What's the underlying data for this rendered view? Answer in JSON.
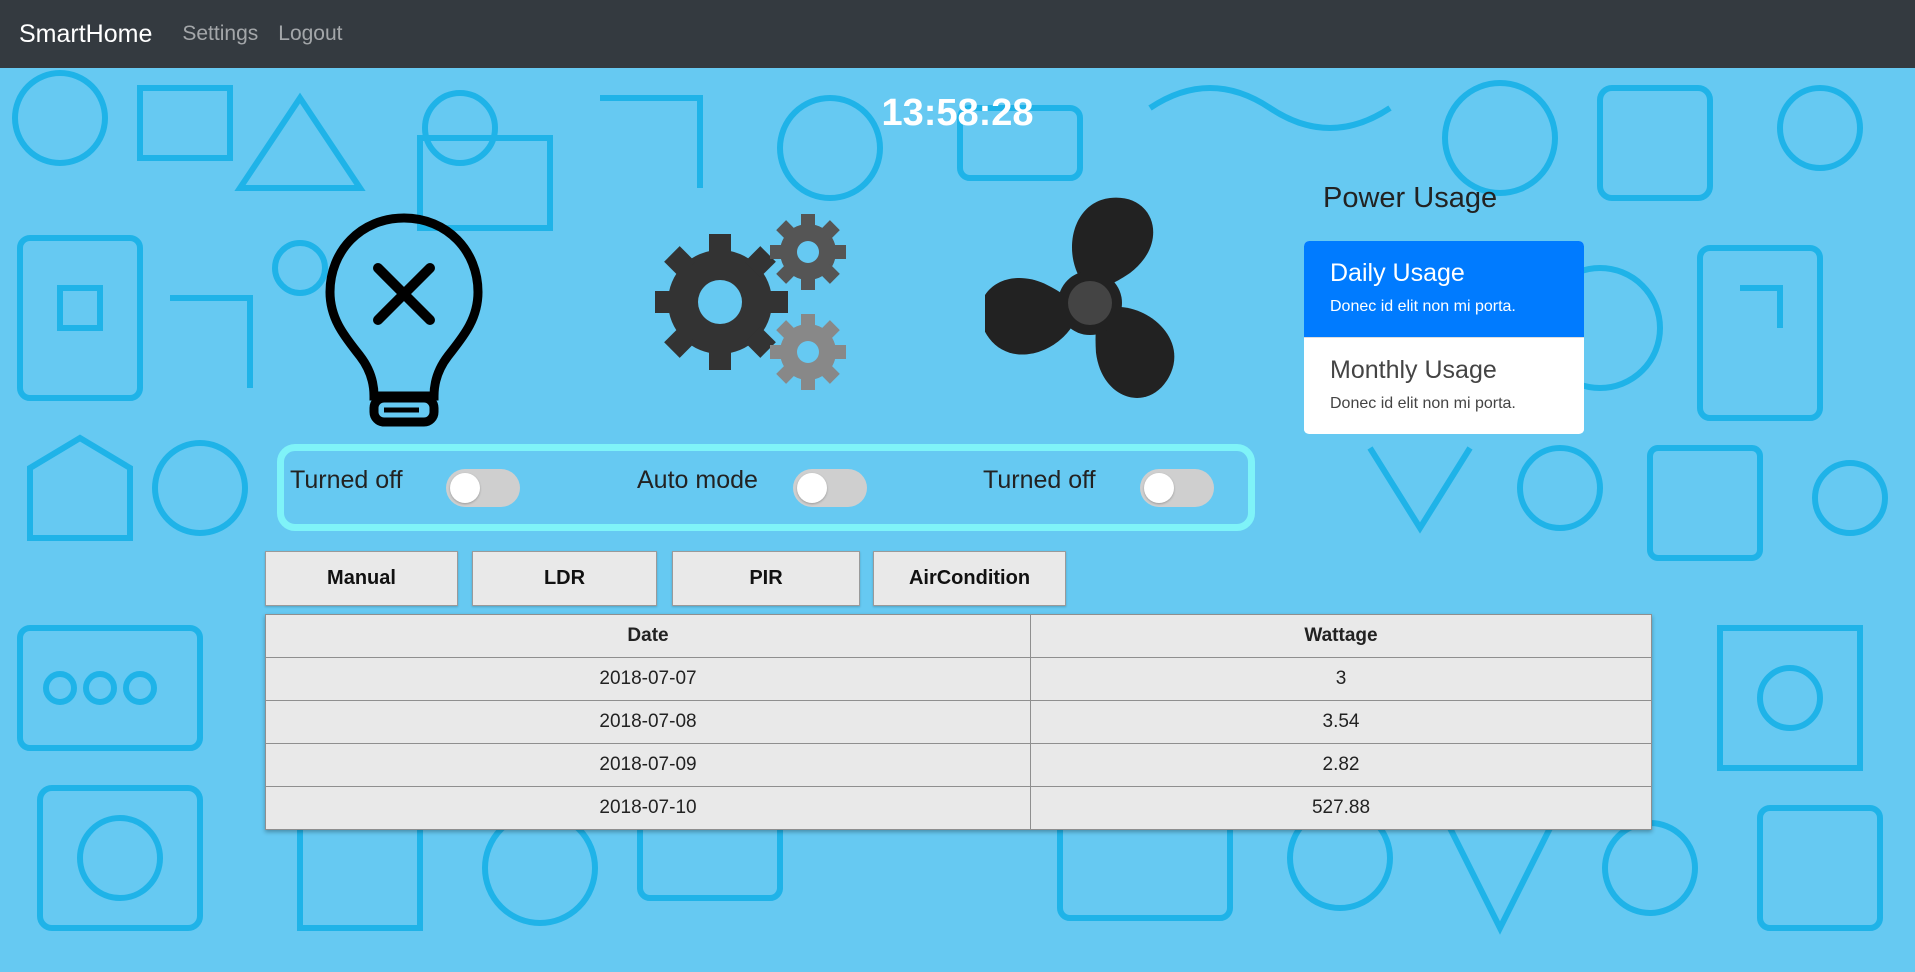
{
  "navbar": {
    "brand": "SmartHome",
    "links": [
      "Settings",
      "Logout"
    ]
  },
  "clock": "13:58:28",
  "devices": {
    "light": {
      "icon": "lightbulb-off-icon",
      "label": "Turned off",
      "on": false
    },
    "auto": {
      "icon": "gears-icon",
      "label": "Auto mode",
      "on": false
    },
    "fan": {
      "icon": "fan-icon",
      "label": "Turned off",
      "on": false
    }
  },
  "power_usage": {
    "title": "Power Usage",
    "items": [
      {
        "title": "Daily Usage",
        "text": "Donec id elit non mi porta.",
        "active": true
      },
      {
        "title": "Monthly Usage",
        "text": "Donec id elit non mi porta.",
        "active": false
      }
    ]
  },
  "mode_buttons": [
    "Manual",
    "LDR",
    "PIR",
    "AirCondition"
  ],
  "table": {
    "headers": [
      "Date",
      "Wattage"
    ],
    "rows": [
      [
        "2018-07-07",
        "3"
      ],
      [
        "2018-07-08",
        "3.54"
      ],
      [
        "2018-07-09",
        "2.82"
      ],
      [
        "2018-07-10",
        "527.88"
      ]
    ]
  },
  "colors": {
    "background": "#66c9f2",
    "pattern": "#1fb3e8",
    "navbar": "#343a40",
    "accent": "#007bff",
    "controls_border": "#7ff3f8"
  }
}
